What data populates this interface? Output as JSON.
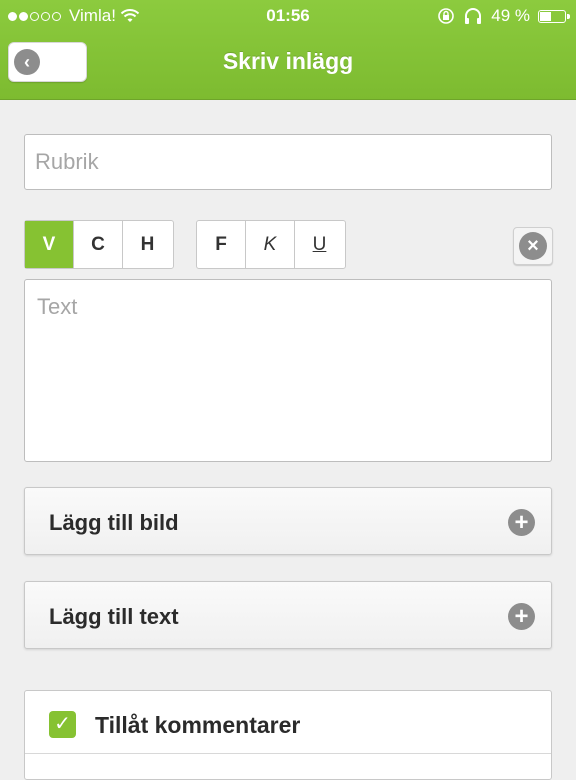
{
  "status_bar": {
    "carrier": "Vimla!",
    "time": "01:56",
    "battery": "49 %",
    "signal_dots_full": 2,
    "signal_dots_total": 5
  },
  "nav": {
    "title": "Skriv inlägg",
    "back_icon": "chevron-left-icon"
  },
  "form": {
    "title_placeholder": "Rubrik",
    "text_placeholder": "Text",
    "align_buttons": [
      "V",
      "C",
      "H"
    ],
    "align_selected": "V",
    "style_buttons": [
      "F",
      "K",
      "U"
    ],
    "add_image_label": "Lägg till bild",
    "add_text_label": "Lägg till text",
    "allow_comments_label": "Tillåt kommentarer",
    "allow_comments_checked": true
  },
  "colors": {
    "accent": "#86c232",
    "icon_gray": "#8d8d8d"
  }
}
